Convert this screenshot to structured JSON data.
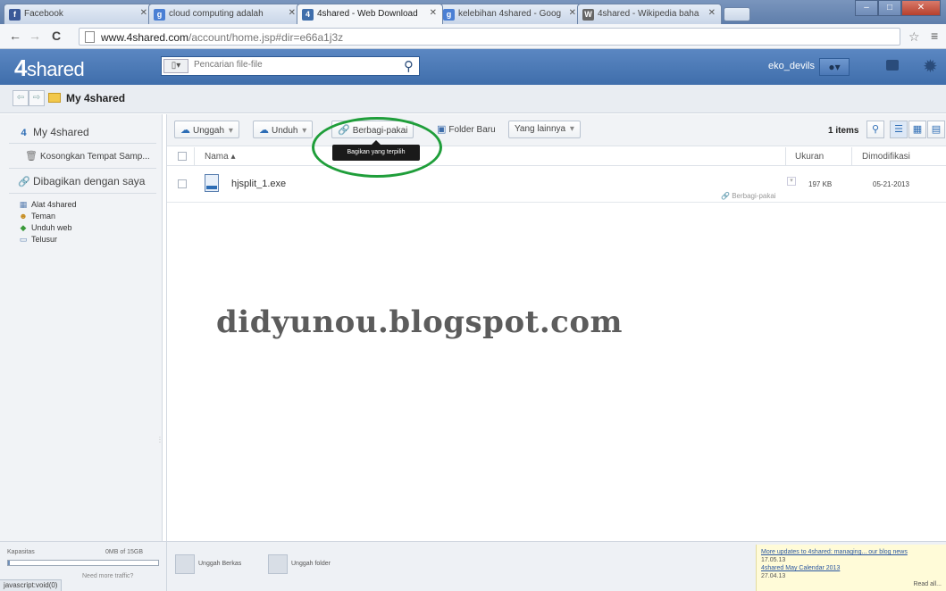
{
  "browser": {
    "tabs": [
      {
        "label": "Facebook",
        "icon": "f",
        "color": "#3b5998"
      },
      {
        "label": "cloud computing adalah",
        "icon": "g",
        "color": "#4a7fd4"
      },
      {
        "label": "4shared - Web Download",
        "icon": "4",
        "color": "#3f6eab"
      },
      {
        "label": "kelebihan 4shared - Goog",
        "icon": "g",
        "color": "#4a7fd4"
      },
      {
        "label": "4shared - Wikipedia baha",
        "icon": "W",
        "color": "#666666"
      }
    ],
    "url_host": "www.4shared.com",
    "url_path": "/account/home.jsp#dir=e66a1j3z"
  },
  "header": {
    "logo_num": "4",
    "logo_text": "shared",
    "search_placeholder": "Pencarian file-file",
    "username": "eko_devils"
  },
  "breadcrumb": {
    "title": "My 4shared"
  },
  "sidebar": {
    "my4shared": "My 4shared",
    "trash": "Kosongkan Tempat Samp...",
    "shared_with_me": "Dibagikan dengan saya",
    "tools": [
      "Alat 4shared",
      "Teman",
      "Unduh web",
      "Telusur"
    ]
  },
  "toolbar": {
    "upload": "Unggah",
    "download": "Unduh",
    "share": "Berbagi-pakai",
    "new_folder": "Folder Baru",
    "more": "Yang lainnya",
    "items_count": "1 items",
    "tooltip": "Bagikan yang terpilih"
  },
  "table": {
    "col_name": "Nama",
    "col_size": "Ukuran",
    "col_date": "Dimodifikasi",
    "rows": [
      {
        "name": "hjsplit_1.exe",
        "size": "197 KB",
        "date": "05-21-2013",
        "share": "Berbagi-pakai"
      }
    ]
  },
  "watermark": "didyunou.blogspot.com",
  "bottom": {
    "capacity_label": "Kapasitas",
    "capacity_value": "0MB of 15GB",
    "capacity_used_fraction": 0.01,
    "need_more": "Need more traffic?",
    "upload_files": "Unggah Berkas",
    "upload_folder": "Unggah folder",
    "news1": "More updates to 4shared: managing... our blog news",
    "news1_date": "17.05.13",
    "news2": "4shared May Calendar 2013",
    "news2_date": "27.04.13",
    "read_all": "Read all..."
  },
  "statusbar": "javascript:void(0)"
}
